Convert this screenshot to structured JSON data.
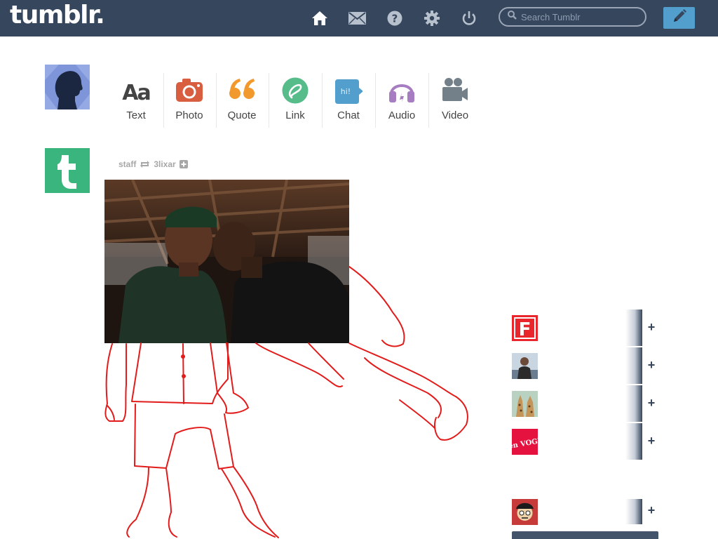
{
  "app": {
    "logo": "tumblr.",
    "brand_color": "#36465d",
    "accent_color": "#529ecc"
  },
  "header": {
    "nav_icons": [
      "home-icon",
      "mail-icon",
      "help-icon",
      "settings-icon",
      "power-icon"
    ],
    "search": {
      "placeholder": "Search Tumblr",
      "value": ""
    },
    "compose_icon": "pencil-icon"
  },
  "post_types": [
    {
      "label": "Text",
      "icon": "text-icon",
      "color": "#444444"
    },
    {
      "label": "Photo",
      "icon": "camera-icon",
      "color": "#d95e40"
    },
    {
      "label": "Quote",
      "icon": "quote-icon",
      "color": "#f2992e"
    },
    {
      "label": "Link",
      "icon": "link-icon",
      "color": "#56bc8a"
    },
    {
      "label": "Chat",
      "icon": "chat-icon",
      "color": "#529ecc"
    },
    {
      "label": "Audio",
      "icon": "headphones-icon",
      "color": "#a77dc2"
    },
    {
      "label": "Video",
      "icon": "video-camera-icon",
      "color": "#748089"
    }
  ],
  "post": {
    "author": "staff",
    "reblogged_from": "3lixar",
    "reblog_icon": "reblog-icon",
    "follow_icon": "plus-icon"
  },
  "recommended": {
    "items": [
      {
        "thumb": "F",
        "thumb_color": "#e8262b"
      },
      {
        "thumb": "",
        "thumb_color": "#c9d6e2"
      },
      {
        "thumb": "",
        "thumb_color": "#b9d1c1"
      },
      {
        "thumb": "teen VOGUE",
        "thumb_color": "#e5123f"
      },
      {
        "thumb": "",
        "thumb_color": "#c63a39"
      }
    ],
    "follow_label": "+"
  }
}
